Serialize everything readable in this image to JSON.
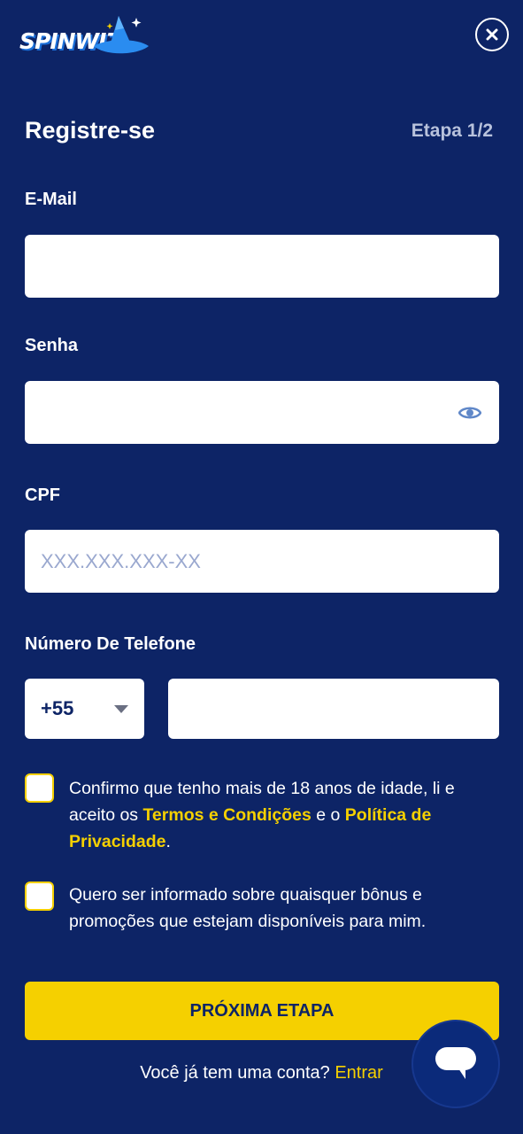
{
  "logo": {
    "text": "SPINWIZ"
  },
  "header": {
    "close_icon": "close-icon"
  },
  "form": {
    "title": "Registre-se",
    "step": "Etapa 1/2",
    "email_label": "E-Mail",
    "email_value": "",
    "password_label": "Senha",
    "password_value": "",
    "password_toggle_icon": "eye-icon",
    "cpf_label": "CPF",
    "cpf_placeholder": "XXX.XXX.XXX-XX",
    "phone_label": "Número De Telefone",
    "country_code": "+55",
    "phone_value": ""
  },
  "terms": {
    "text_before": "Confirmo que tenho mais de 18 anos de idade, li e aceito os ",
    "terms_link": "Termos e Condições",
    "text_middle": " e o ",
    "privacy_link": "Política de Privacidade",
    "text_after": "."
  },
  "marketing": {
    "text": "Quero ser informado sobre quaisquer bônus e promoções que estejam disponíveis para mim."
  },
  "submit_label": "PRÓXIMA ETAPA",
  "login": {
    "prompt": "Você já tem uma conta?",
    "link": "Entrar"
  },
  "chat": {
    "icon": "chat-bubble-icon"
  },
  "colors": {
    "background": "#0d2466",
    "accent": "#f5d000",
    "input_background": "#ffffff",
    "step_text": "#b8c2dc"
  }
}
